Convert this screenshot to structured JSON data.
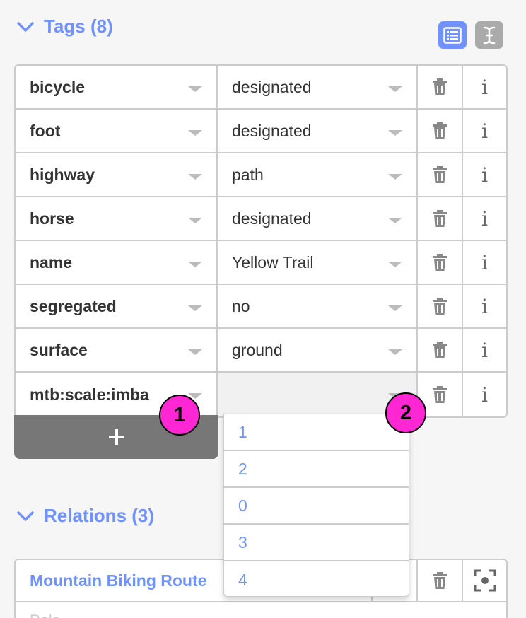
{
  "tags_section": {
    "title": "Tags (8)",
    "view_list_icon": "list-view-icon",
    "view_text_icon": "text-view-icon",
    "rows": [
      {
        "key": "bicycle",
        "value": "designated"
      },
      {
        "key": "foot",
        "value": "designated"
      },
      {
        "key": "highway",
        "value": "path"
      },
      {
        "key": "horse",
        "value": "designated"
      },
      {
        "key": "name",
        "value": "Yellow Trail"
      },
      {
        "key": "segregated",
        "value": "no"
      },
      {
        "key": "surface",
        "value": "ground"
      },
      {
        "key": "mtb:scale:imba",
        "value": ""
      }
    ],
    "add_label": "+"
  },
  "markers": {
    "one": "1",
    "two": "2"
  },
  "value_dropdown": {
    "options": [
      "1",
      "2",
      "0",
      "3",
      "4"
    ]
  },
  "relations_section": {
    "title": "Relations (3)",
    "first_relation": {
      "name": "Mountain Biking Route",
      "role_placeholder": "Role"
    }
  },
  "colors": {
    "accent": "#7092ff",
    "marker": "#ff26d4",
    "button": "#777777"
  }
}
